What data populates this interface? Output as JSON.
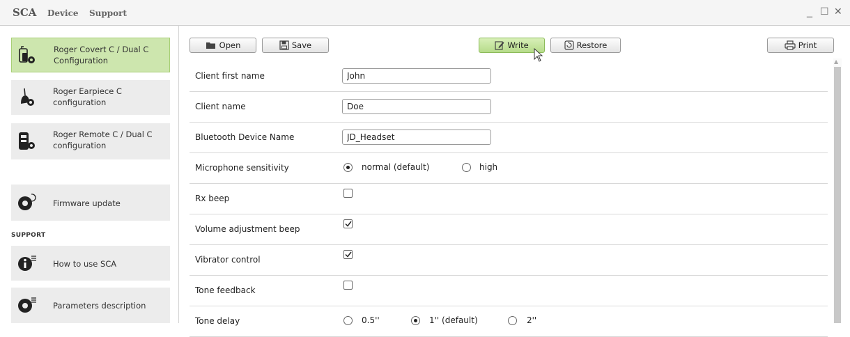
{
  "window": {
    "app_title": "SCA",
    "menu": [
      "Device",
      "Support"
    ],
    "controls": {
      "minimize": "_",
      "maximize": "☐",
      "close": "✕"
    }
  },
  "sidebar": {
    "items": [
      {
        "label_line1": "Roger Covert C / Dual C",
        "label_line2": "Configuration",
        "icon": "covert-device-icon",
        "active": true
      },
      {
        "label_line1": "Roger Earpiece C",
        "label_line2": "configuration",
        "icon": "earpiece-icon",
        "active": false
      },
      {
        "label_line1": "Roger Remote C / Dual C",
        "label_line2": "configuration",
        "icon": "remote-device-icon",
        "active": false
      },
      {
        "label_line1": "Firmware update",
        "label_line2": "",
        "icon": "firmware-update-icon",
        "active": false
      }
    ],
    "support_heading": "SUPPORT",
    "support_items": [
      {
        "label": "How to use SCA",
        "icon": "info-icon"
      },
      {
        "label": "Parameters description",
        "icon": "gear-list-icon"
      }
    ]
  },
  "toolbar": {
    "open_label": "Open",
    "save_label": "Save",
    "write_label": "Write",
    "restore_label": "Restore",
    "print_label": "Print"
  },
  "form": {
    "client_first_name": {
      "label": "Client first name",
      "value": "John"
    },
    "client_name": {
      "label": "Client name",
      "value": "Doe"
    },
    "bluetooth_name": {
      "label": "Bluetooth Device Name",
      "value": "JD_Headset"
    },
    "mic_sensitivity": {
      "label": "Microphone sensitivity",
      "options": [
        "normal (default)",
        "high"
      ],
      "selected": "normal (default)"
    },
    "rx_beep": {
      "label": "Rx beep",
      "checked": false
    },
    "volume_beep": {
      "label": "Volume adjustment beep",
      "checked": true
    },
    "vibrator_control": {
      "label": "Vibrator control",
      "checked": true
    },
    "tone_feedback": {
      "label": "Tone feedback",
      "checked": false
    },
    "tone_delay": {
      "label": "Tone delay",
      "options": [
        "0.5''",
        "1'' (default)",
        "2''"
      ],
      "selected": "1'' (default)"
    }
  },
  "colors": {
    "active_item": "#cde6ae",
    "write_button": "#b6dc8a",
    "sidebar_item": "#ececec"
  }
}
